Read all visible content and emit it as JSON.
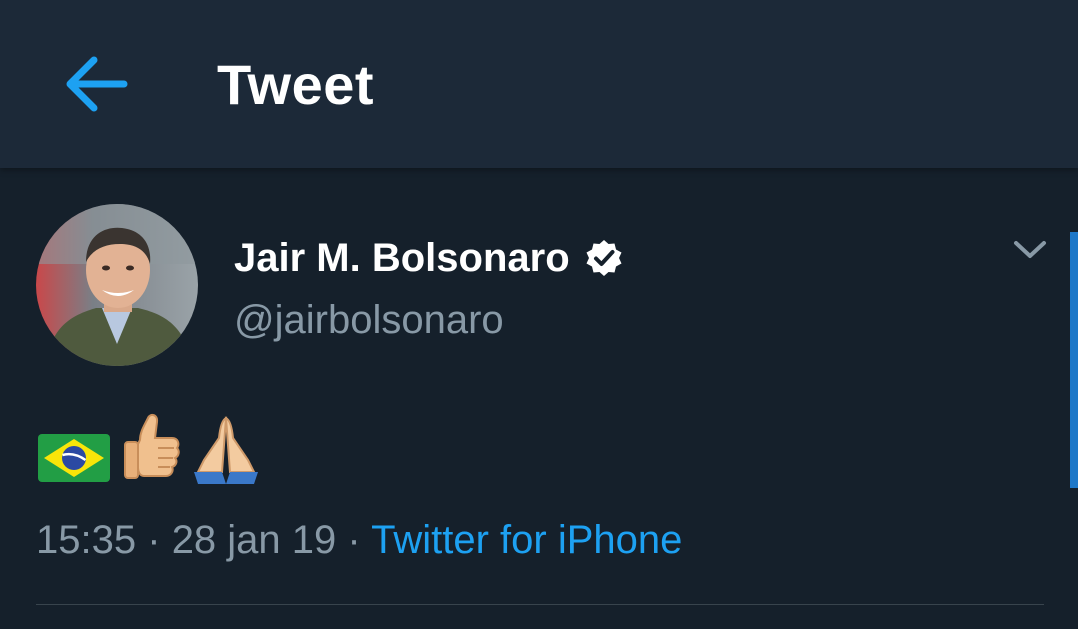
{
  "header": {
    "back_icon": "arrow-left-icon",
    "title": "Tweet"
  },
  "tweet": {
    "author_name": "Jair M. Bolsonaro",
    "verified_icon": "verified-badge-icon",
    "handle": "@jairbolsonaro",
    "menu_icon": "chevron-down-icon",
    "emojis": [
      "brazil-flag-emoji",
      "thumbs-up-emoji",
      "folded-hands-emoji"
    ],
    "time": "15:35",
    "separator": "·",
    "date": "28 jan 19",
    "source": "Twitter for iPhone"
  },
  "colors": {
    "background": "#15202b",
    "appbar": "#1c2938",
    "accent": "#1da1f2",
    "secondary_text": "#8899a6"
  }
}
